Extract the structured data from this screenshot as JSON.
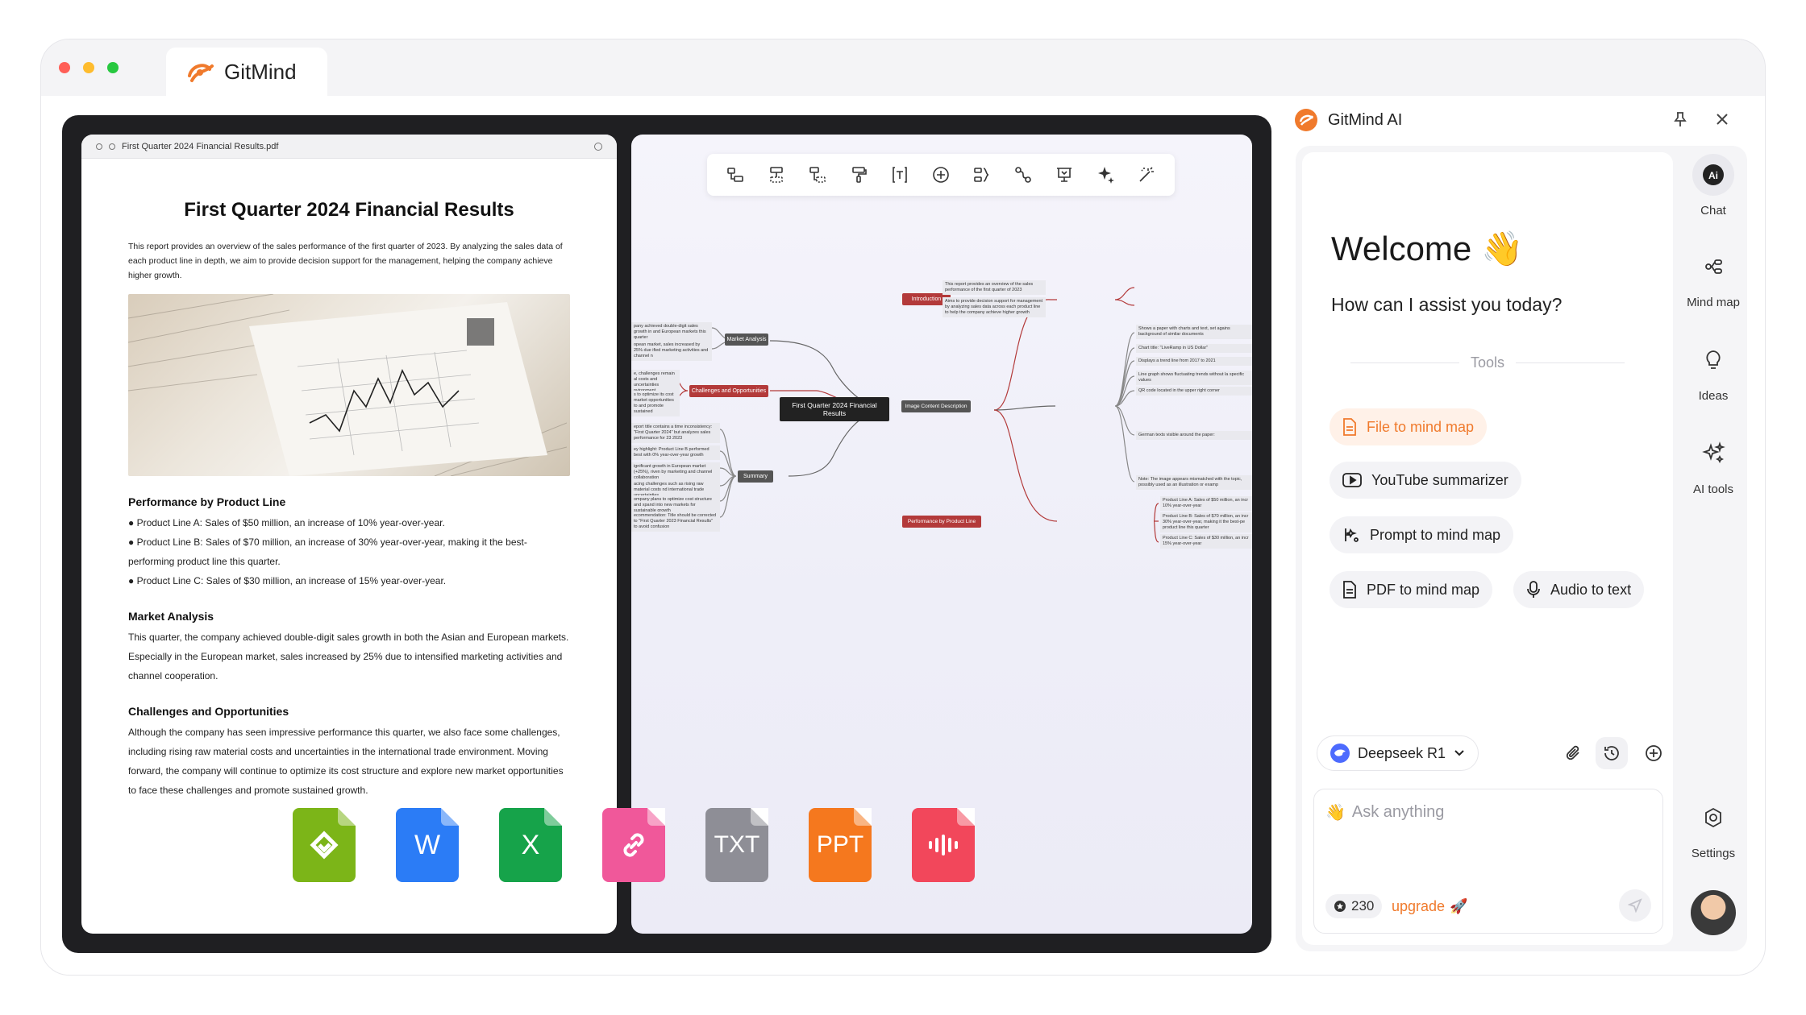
{
  "window": {
    "tab_title": "GitMind",
    "accent": "#f07a2c"
  },
  "document": {
    "filename": "First Quarter 2024 Financial Results.pdf",
    "title": "First Quarter 2024 Financial Results",
    "intro": "This report provides an overview of the sales performance of  the first quarter of 2023.  By analyzing the sales data of each product line in depth, we aim to provide decision support for the management, helping the company achieve higher growth.",
    "sections": [
      {
        "heading": "Performance by Product Line",
        "lines": [
          "● Product Line A: Sales of $50 million, an increase of 10% year-over-year.",
          "● Product Line B: Sales of $70 million, an increase of 30% year-over-year, making it the best-performing product line this quarter.",
          "● Product Line C: Sales of $30 million, an increase of 15% year-over-year."
        ]
      },
      {
        "heading": "Market Analysis",
        "lines": [
          "This quarter, the company achieved double-digit sales growth in both the Asian and European markets. Especially in the European market, sales increased by 25% due to intensified marketing activities and channel cooperation."
        ]
      },
      {
        "heading": "Challenges and Opportunities",
        "lines": [
          "Although the company has seen impressive performance this quarter, we also face some challenges, including rising raw material costs and uncertainties in the international trade environment. Moving forward, the company will continue to optimize its cost structure and explore new market opportunities to face these challenges and promote sustained growth."
        ]
      }
    ]
  },
  "mindmap": {
    "toolbar_icons": [
      "add-child-icon",
      "add-sibling-icon",
      "add-parent-icon",
      "format-painter-icon",
      "text-icon",
      "add-topic-icon",
      "summary-icon",
      "relation-icon",
      "presentation-icon",
      "ai-sparkle-icon",
      "magic-wand-icon"
    ],
    "root": "First Quarter 2024 Financial Results",
    "branches": {
      "introduction": "Introduction",
      "market": "Market Analysis",
      "challenges": "Challenges and Opportunities",
      "summary": "Summary",
      "image": "Image Content Description",
      "performance": "Performance by Product Line"
    },
    "leaves": {
      "intro_1": "This report provides an overview of the sales performance of the first quarter of 2023",
      "intro_2": "Aims to provide decision support for management by analyzing sales data across each product line to help the company achieve higher growth",
      "market_1": "pany achieved double-digit sales growth in and European markets this quarter",
      "market_2": "opean market, sales increased by 25% due ified marketing activities and channel n",
      "chal_1": "e, challenges remain al costs and uncertainties nvironment",
      "chal_2": "s to optimize its cost market opportunities to and promote sustained",
      "sum_1": "eport title contains a time inconsistency: \"First Quarter 2024\" but analyzes sales performance for 23 2023",
      "sum_2": "ey highlight: Product Line B performed best with 0% year-over-year growth",
      "sum_3": "ignificant growth in European market (+25%), riven by marketing and channel collaboration",
      "sum_4": "acing challenges such as rising raw material costs nd international trade uncertainties",
      "sum_5": "ompany plans to optimize cost structure and xpand into new markets for sustainable growth",
      "sum_6": "ecommendation: Title should be corrected to \"First Quarter 2023 Financial Results\" to avoid confusion",
      "img_1": "Shows a paper with charts and text, set agains background of similar documents",
      "img_2": "Chart title: \"LiveRamp in US Dollar\"",
      "img_3": "Displays a trend line from 2017 to 2021",
      "img_4": "Line graph shows fluctuating trends without la specific values",
      "img_5": "QR code located in the upper right corner",
      "img_6": "German texts visible around the paper:",
      "img_7": "Note: The image appears mismatched with the topic, possibly used as an illustration or examp",
      "perf_1": "Product Line A: Sales of $50 million, an incr 10% year-over-year",
      "perf_2": "Product Line B: Sales of $70 million, an incr 30% year-over-year, making it the best-pe product line this quarter",
      "perf_3": "Product Line C: Sales of $30 million, an incr 15% year-over-year"
    }
  },
  "file_types": [
    {
      "name": "gitmind-file-icon",
      "label": "",
      "color": "#7cb518"
    },
    {
      "name": "word-file-icon",
      "label": "W",
      "color": "#2b7cf6"
    },
    {
      "name": "excel-file-icon",
      "label": "X",
      "color": "#16a34a"
    },
    {
      "name": "link-file-icon",
      "label": "",
      "color": "#f0589a"
    },
    {
      "name": "txt-file-icon",
      "label": "TXT",
      "color": "#8e8e96"
    },
    {
      "name": "ppt-file-icon",
      "label": "PPT",
      "color": "#f5781e"
    },
    {
      "name": "audio-file-icon",
      "label": "",
      "color": "#f2475b"
    }
  ],
  "ai": {
    "title": "GitMind AI",
    "welcome": "Welcome 👋",
    "assist": "How can I assist you today?",
    "tools_label": "Tools",
    "tools": {
      "file_to_mind_map": "File to mind map",
      "youtube": "YouTube summarizer",
      "prompt": "Prompt to mind map",
      "pdf": "PDF to mind map",
      "audio": "Audio to text"
    },
    "model": "Deepseek R1",
    "input_placeholder": "Ask anything",
    "credits": "230",
    "upgrade": "upgrade"
  },
  "nav": {
    "chat": "Chat",
    "mindmap": "Mind map",
    "ideas": "Ideas",
    "ai_tools": "AI tools",
    "settings": "Settings"
  }
}
